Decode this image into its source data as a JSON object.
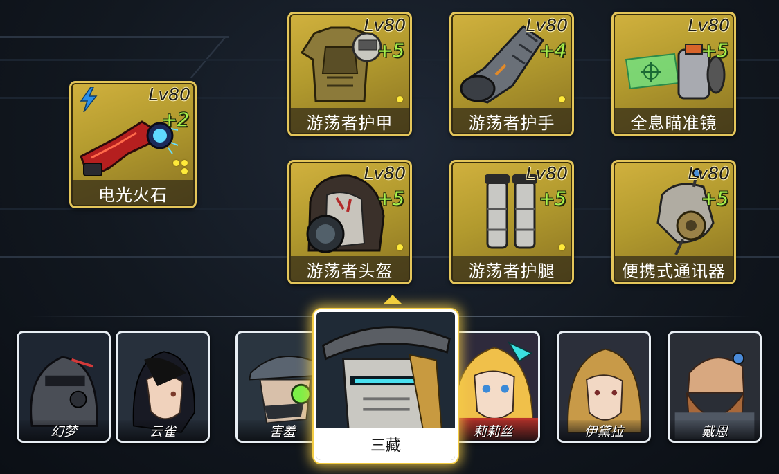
{
  "equipment": {
    "weapon": {
      "name": "电光火石",
      "level": "Lv80",
      "plus": "+2",
      "icon": "red-pistol-icon",
      "badge_icon": "lightning-bolt-icon"
    },
    "armor": {
      "name": "游荡者护甲",
      "level": "Lv80",
      "plus": "+5",
      "icon": "chest-armor-icon"
    },
    "gloves": {
      "name": "游荡者护手",
      "level": "Lv80",
      "plus": "+4",
      "icon": "gauntlet-icon"
    },
    "scope": {
      "name": "全息瞄准镜",
      "level": "Lv80",
      "plus": "+5",
      "icon": "holo-scope-icon"
    },
    "helmet": {
      "name": "游荡者头盔",
      "level": "Lv80",
      "plus": "+5",
      "icon": "hooded-mask-icon"
    },
    "legs": {
      "name": "游荡者护腿",
      "level": "Lv80",
      "plus": "+5",
      "icon": "armored-boots-icon"
    },
    "comm": {
      "name": "便携式通讯器",
      "level": "Lv80",
      "plus": "+5",
      "icon": "comm-device-icon"
    }
  },
  "heroes": [
    {
      "name": "幻梦"
    },
    {
      "name": "云雀"
    },
    {
      "name": "害羞"
    },
    {
      "name": "三藏",
      "selected": true
    },
    {
      "name": "莉莉丝"
    },
    {
      "name": "伊黛拉"
    },
    {
      "name": "戴恩"
    }
  ],
  "colors": {
    "slot_gold": "#c9a93a",
    "slot_border": "#e4c65a",
    "plus_green": "#a6f04a",
    "rank_dot": "#ffea3a",
    "select_glow": "#f3cf47"
  }
}
